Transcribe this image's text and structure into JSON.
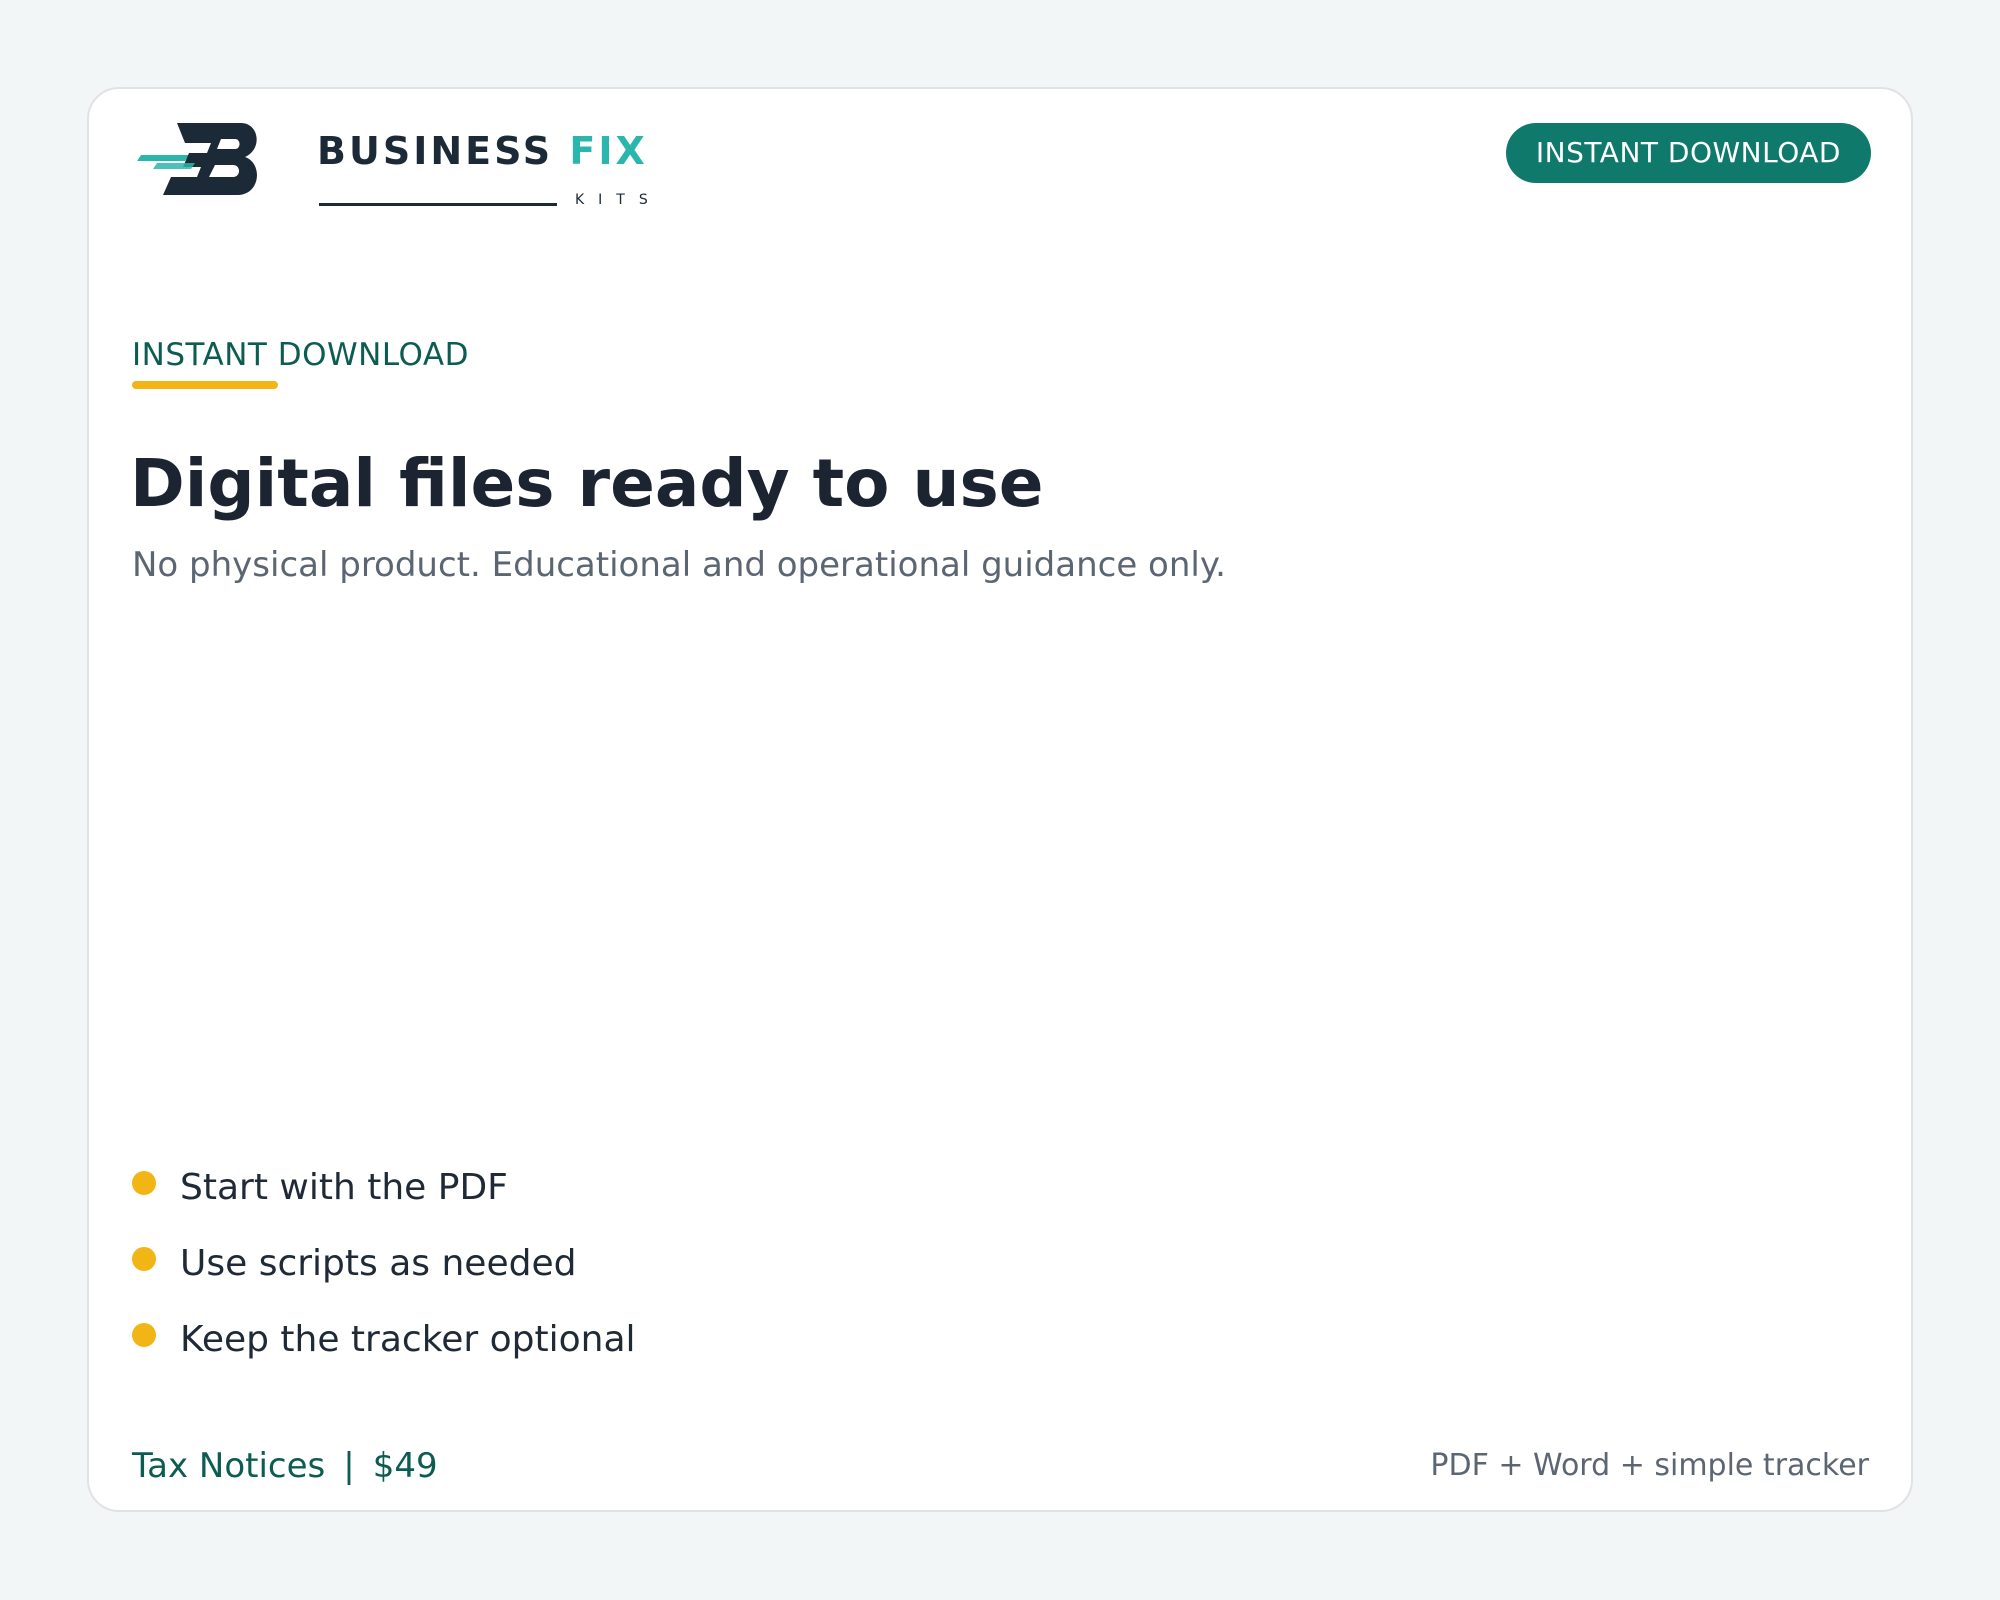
{
  "brand": {
    "word1": "BUSINESS",
    "word2": "FIX",
    "tagline": "KITS",
    "colors": {
      "dark": "#1c2a38",
      "teal": "#2bb6ad"
    }
  },
  "header": {
    "cta_label": "INSTANT DOWNLOAD"
  },
  "hero": {
    "eyebrow": "INSTANT DOWNLOAD",
    "title": "Digital files ready to use",
    "subtitle": "No physical product. Educational and operational guidance only."
  },
  "bullets": [
    {
      "text": "Start with the PDF"
    },
    {
      "text": "Use scripts as needed"
    },
    {
      "text": "Keep the tracker optional"
    }
  ],
  "footer": {
    "product": "Tax Notices",
    "separator": "|",
    "price": "$49",
    "formats": "PDF + Word + simple tracker"
  },
  "colors": {
    "accent_green": "#0f7a6c",
    "label_green": "#0d5c52",
    "bullet_yellow": "#f2b516",
    "page_bg": "#f3f6f7"
  },
  "icons": {
    "logo": "fb-monogram-icon",
    "bullet": "dot-icon"
  }
}
